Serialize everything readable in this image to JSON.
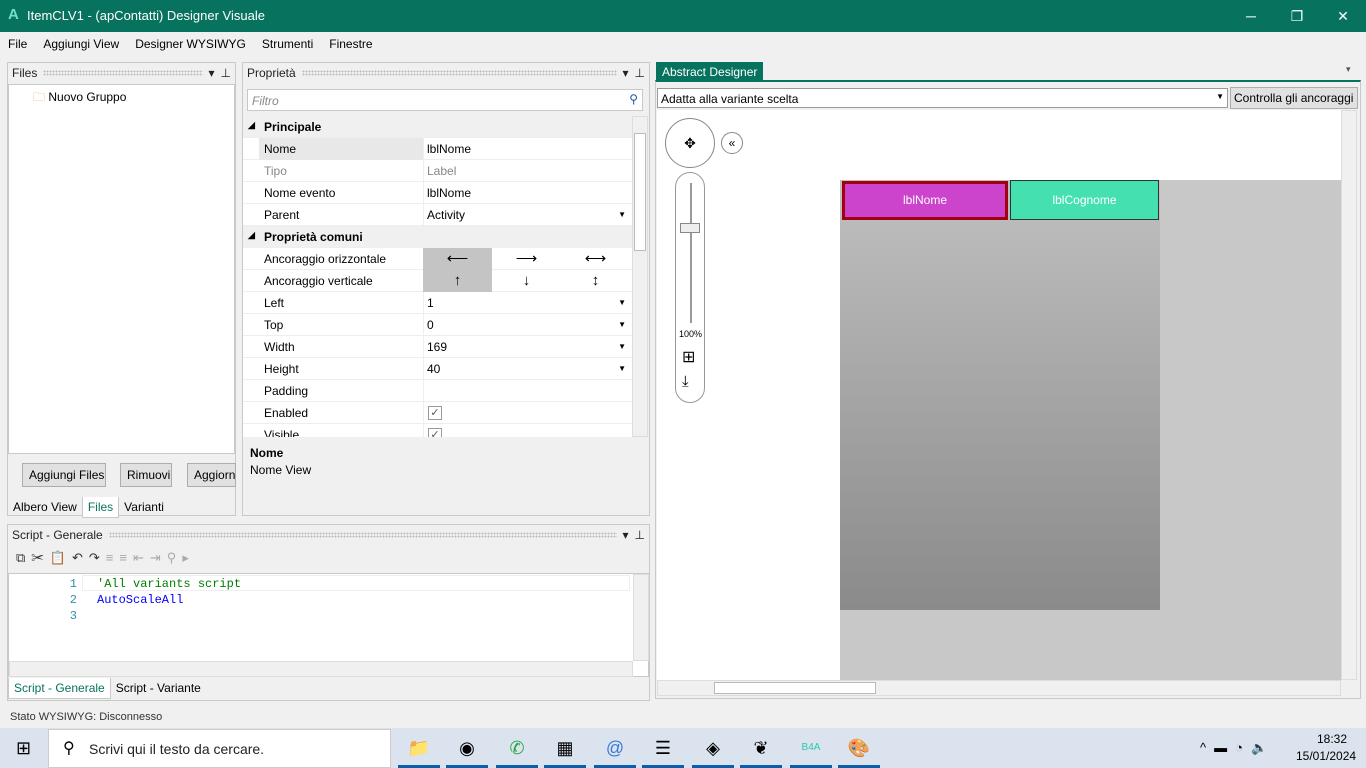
{
  "window": {
    "title": "ItemCLV1 - (apContatti) Designer Visuale",
    "logo": "A",
    "minimize": "─",
    "maximize": "❐",
    "close": "✕"
  },
  "menu": [
    "File",
    "Aggiungi View",
    "Designer WYSIWYG",
    "Strumenti",
    "Finestre"
  ],
  "files_panel": {
    "title": "Files",
    "tree": [
      {
        "label": "Nuovo Gruppo",
        "icon": "folder-icon"
      }
    ],
    "buttons": [
      "Aggiungi Files",
      "Rimuovi",
      "Aggiorn"
    ],
    "tabs": [
      "Albero View",
      "Files",
      "Varianti"
    ],
    "active_tab": "Files"
  },
  "properties": {
    "title": "Proprietà",
    "filter_placeholder": "Filtro",
    "rows": [
      {
        "cat": "Principale"
      },
      {
        "label": "Nome",
        "value": "lblNome"
      },
      {
        "label": "Tipo",
        "value": "Label",
        "disabled": true
      },
      {
        "label": "Nome evento",
        "value": "lblNome"
      },
      {
        "label": "Parent",
        "value": "Activity",
        "dropdown": true
      },
      {
        "cat": "Proprietà comuni"
      },
      {
        "label": "Ancoraggio orizzontale",
        "arrows": [
          "⟵",
          "⟶",
          "⟷"
        ]
      },
      {
        "label": "Ancoraggio verticale",
        "arrows": [
          "↑",
          "↓",
          "↕"
        ]
      },
      {
        "label": "Left",
        "value": "1",
        "dropdown": true
      },
      {
        "label": "Top",
        "value": "0",
        "dropdown": true
      },
      {
        "label": "Width",
        "value": "169",
        "dropdown": true
      },
      {
        "label": "Height",
        "value": "40",
        "dropdown": true
      },
      {
        "label": "Padding",
        "value": ""
      },
      {
        "label": "Enabled",
        "value": "✓",
        "checkbox": true
      },
      {
        "label": "Visible",
        "value": "✓",
        "checkbox": true
      }
    ],
    "desc_title": "Nome",
    "desc_text": "Nome View"
  },
  "script_panel": {
    "title": "Script - Generale",
    "lines": [
      {
        "n": "1",
        "text": "'All variants script",
        "color": "#008000"
      },
      {
        "n": "2",
        "text": "AutoScaleAll",
        "color": "#0000ff"
      },
      {
        "n": "3",
        "text": ""
      }
    ],
    "tabs": [
      "Script - Generale",
      "Script - Variante"
    ]
  },
  "designer": {
    "tab": "Abstract Designer",
    "variant_select": "Adatta alla variante scelta",
    "check_button": "Controlla gli ancoraggi",
    "zoom": "100%",
    "views": [
      {
        "name": "lblNome",
        "color": "#cc44cc",
        "selected": true
      },
      {
        "name": "lblCognome",
        "color": "#44e0b0"
      }
    ]
  },
  "status": "Stato WYSIWYG: Disconnesso",
  "taskbar": {
    "search_placeholder": "Scrivi qui il testo da cercare.",
    "time": "18:32",
    "date": "15/01/2024",
    "accent": "#07735f"
  }
}
